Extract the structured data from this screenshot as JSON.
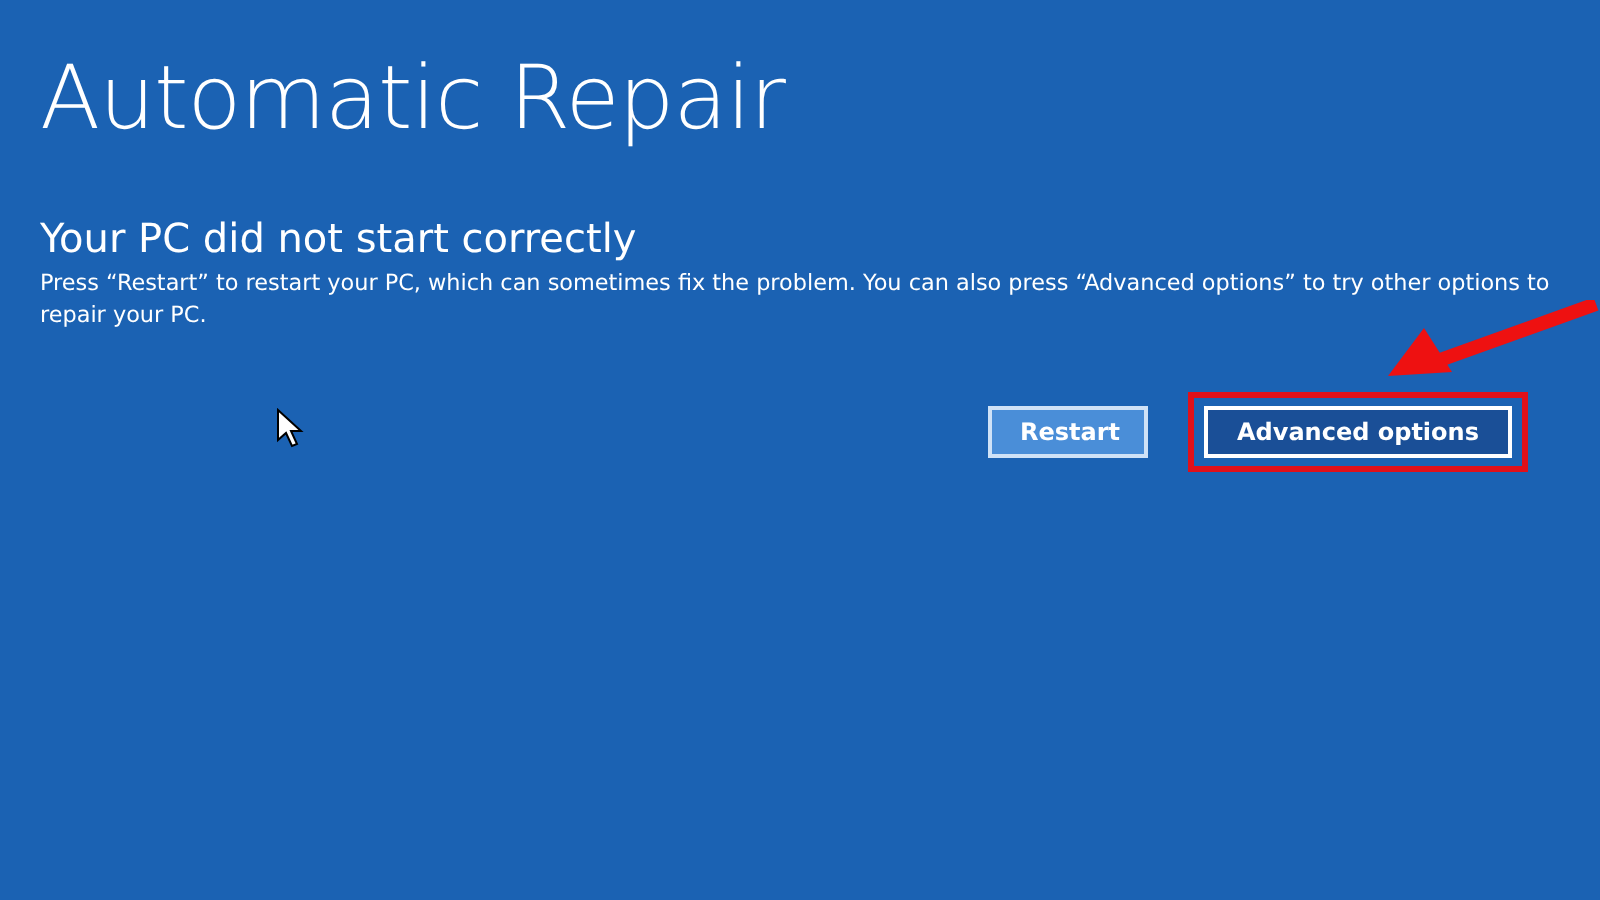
{
  "title": "Automatic Repair",
  "heading": "Your PC did not start correctly",
  "message": "Press “Restart” to restart your PC, which can sometimes fix the problem. You can also press “Advanced options” to try other options to repair your PC.",
  "buttons": [
    {
      "label": "Restart",
      "focused": false,
      "highlighted": false
    },
    {
      "label": "Advanced options",
      "focused": true,
      "highlighted": true
    }
  ]
}
